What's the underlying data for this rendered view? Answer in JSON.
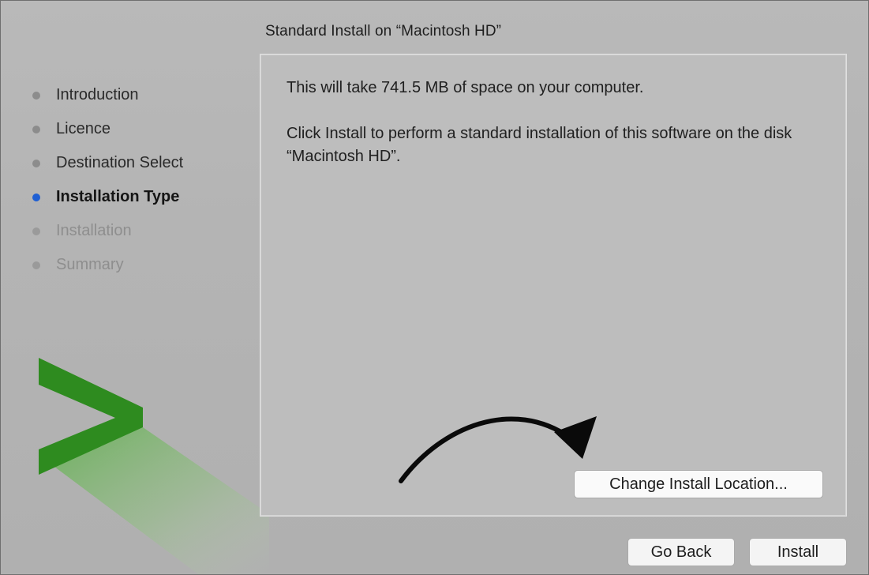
{
  "window": {
    "title": "Standard Install on “Macintosh HD”"
  },
  "sidebar": {
    "steps": [
      {
        "label": "Introduction",
        "state": "done"
      },
      {
        "label": "Licence",
        "state": "done"
      },
      {
        "label": "Destination Select",
        "state": "done"
      },
      {
        "label": "Installation Type",
        "state": "active"
      },
      {
        "label": "Installation",
        "state": "pending"
      },
      {
        "label": "Summary",
        "state": "pending"
      }
    ],
    "logo_icon": "green-chevron-logo-icon"
  },
  "main": {
    "space_message": "This will take 741.5 MB of space on your computer.",
    "install_message": "Click Install to perform a standard installation of this software on the disk “Macintosh HD”.",
    "annotation_icon": "curved-arrow-icon",
    "change_location_label": "Change Install Location..."
  },
  "footer": {
    "go_back_label": "Go Back",
    "install_label": "Install"
  },
  "colors": {
    "active_step_dot": "#1f5fd3",
    "logo_green": "#2e8b1f",
    "window_background": "#b6b6b6"
  }
}
